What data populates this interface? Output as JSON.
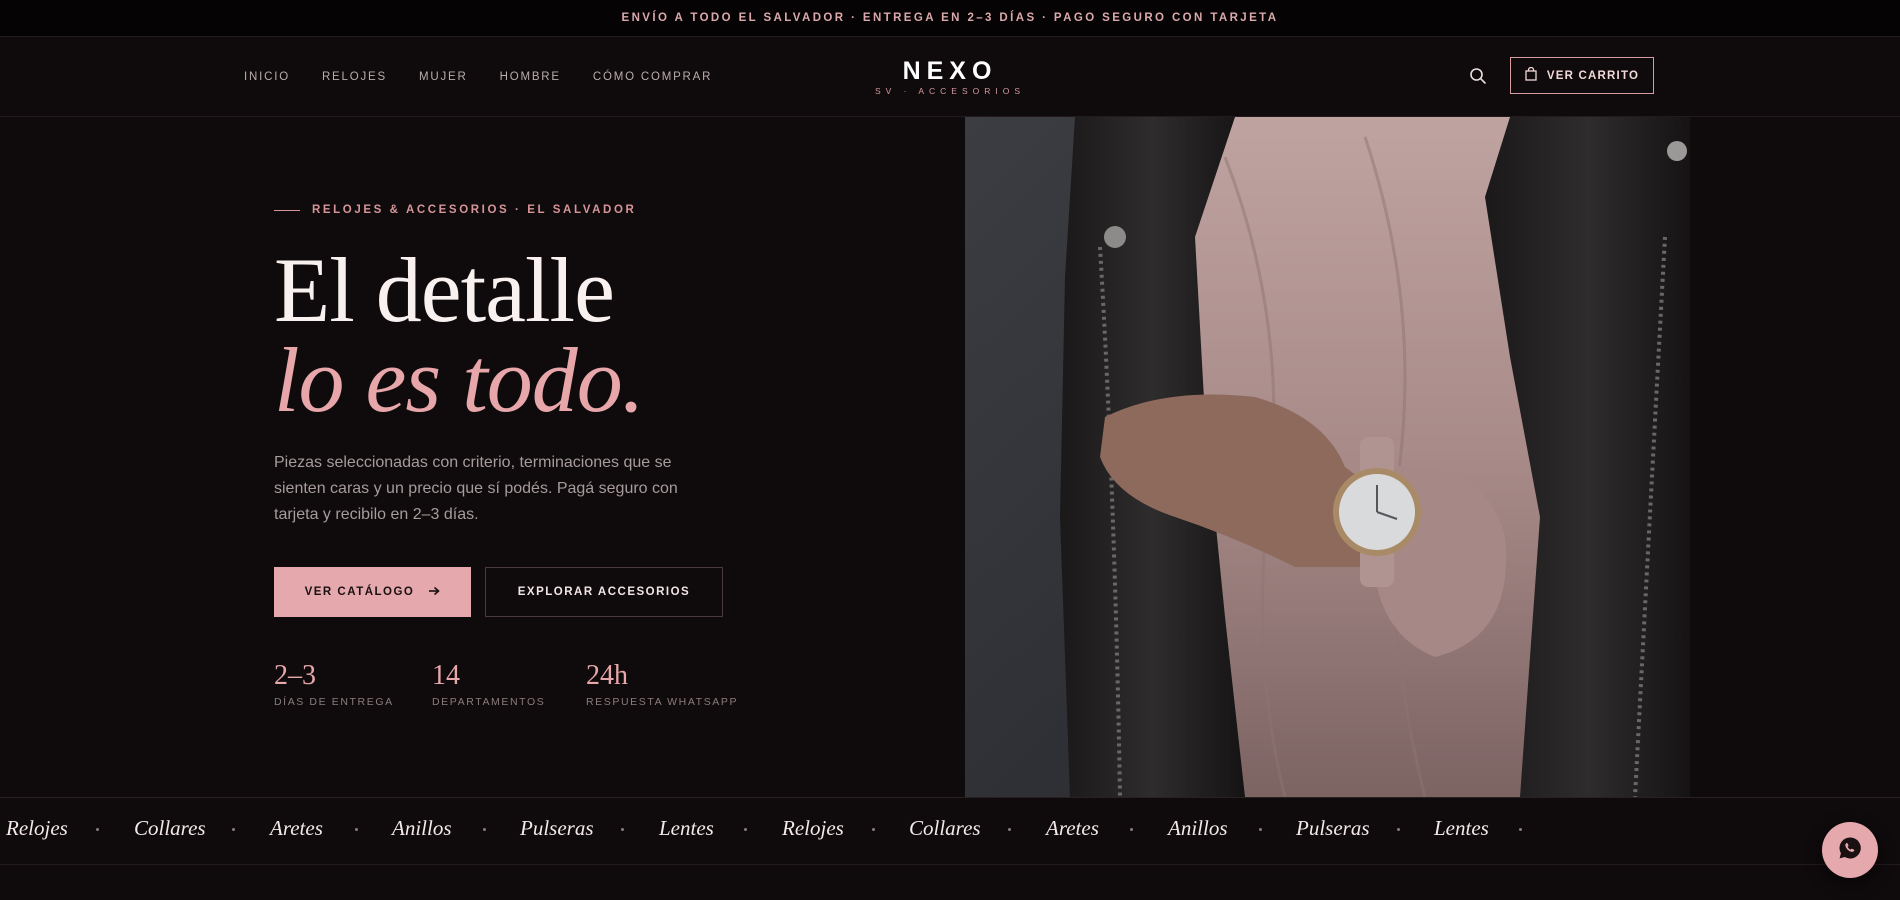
{
  "topbar": {
    "text": "ENVÍO A TODO EL SALVADOR · ENTREGA EN 2–3 DÍAS · PAGO SEGURO CON TARJETA"
  },
  "nav": {
    "items": [
      {
        "label": "INICIO"
      },
      {
        "label": "RELOJES"
      },
      {
        "label": "MUJER"
      },
      {
        "label": "HOMBRE"
      },
      {
        "label": "CÓMO COMPRAR"
      }
    ]
  },
  "brand": {
    "name": "NEXO",
    "tagline": "SV · ACCESORIOS"
  },
  "header": {
    "search_icon": "search-icon",
    "cart_label": "VER CARRITO",
    "cart_icon": "bag-icon"
  },
  "hero": {
    "eyebrow": "RELOJES & ACCESORIOS · EL SALVADOR",
    "title_line1": "El detalle",
    "title_line2": "lo es todo.",
    "description": "Piezas seleccionadas con criterio, terminaciones que se sienten caras y un precio que sí podés. Pagá seguro con tarjeta y recibilo en 2–3 días.",
    "primary_button": "VER CATÁLOGO",
    "primary_icon": "arrow-right-icon",
    "secondary_button": "EXPLORAR ACCESORIOS",
    "stats": [
      {
        "value": "2–3",
        "label": "DÍAS DE ENTREGA"
      },
      {
        "value": "14",
        "label": "DEPARTAMENTOS"
      },
      {
        "value": "24h",
        "label": "RESPUESTA WHATSAPP"
      }
    ]
  },
  "ticker": {
    "items": [
      "Relojes",
      "Collares",
      "Aretes",
      "Anillos",
      "Pulseras",
      "Lentes",
      "Relojes",
      "Collares",
      "Aretes",
      "Anillos",
      "Pulseras",
      "Lentes"
    ]
  },
  "colors": {
    "accent": "#e5a8ad",
    "background": "#0f0a0b",
    "topbar_text": "#dba9ab"
  },
  "whatsapp": {
    "icon": "whatsapp-icon"
  }
}
